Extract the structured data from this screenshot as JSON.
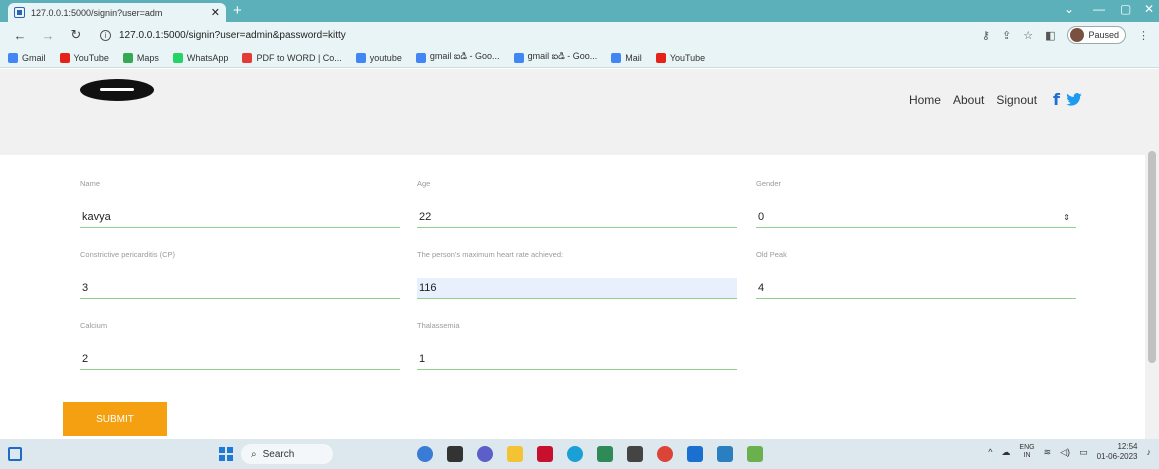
{
  "browser": {
    "tab_title": "127.0.0.1:5000/signin?user=adm",
    "url": "127.0.0.1:5000/signin?user=admin&password=kitty",
    "profile_status": "Paused",
    "bookmarks": [
      {
        "label": "Gmail",
        "color": "#4285f4"
      },
      {
        "label": "YouTube",
        "color": "#e62117"
      },
      {
        "label": "Maps",
        "color": "#34a853"
      },
      {
        "label": "WhatsApp",
        "color": "#25d366"
      },
      {
        "label": "PDF to WORD | Co...",
        "color": "#e53935"
      },
      {
        "label": "youtube",
        "color": "#4285f4"
      },
      {
        "label": "gmail ఐడి - Goo...",
        "color": "#4285f4"
      },
      {
        "label": "gmail ఐడి - Goo...",
        "color": "#4285f4"
      },
      {
        "label": "Mail",
        "color": "#4285f4"
      },
      {
        "label": "YouTube",
        "color": "#e62117"
      }
    ]
  },
  "nav": {
    "home": "Home",
    "about": "About",
    "signout": "Signout",
    "facebook_glyph": "f"
  },
  "form": {
    "name": {
      "label": "Name",
      "value": "kavya"
    },
    "age": {
      "label": "Age",
      "value": "22"
    },
    "gender": {
      "label": "Gender",
      "value": "0"
    },
    "cp": {
      "label": "Constrictive pericarditis (CP)",
      "value": "3"
    },
    "max_hr": {
      "label": "The person's maximum heart rate achieved:",
      "value": "116"
    },
    "old_peak": {
      "label": "Old Peak",
      "value": "4"
    },
    "calcium": {
      "label": "Calcium",
      "value": "2"
    },
    "thal": {
      "label": "Thalassemia",
      "value": "1"
    },
    "submit_label": "SUBMIT"
  },
  "taskbar": {
    "search_placeholder": "Search",
    "lang_top": "ENG",
    "lang_bottom": "IN",
    "time": "12:54",
    "date": "01-06-2023"
  },
  "colors": {
    "accent": "#f4a010",
    "underline": "#8fcf8f",
    "tabstrip": "#5bb0ba"
  }
}
